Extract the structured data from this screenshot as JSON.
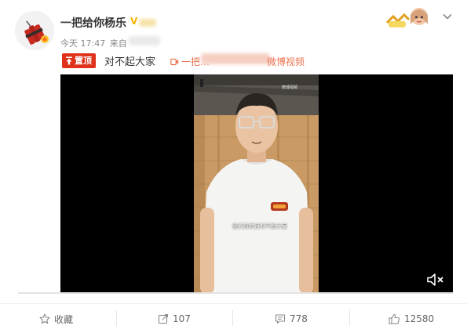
{
  "post": {
    "author": "一把给你杨乐",
    "verified_mark": "V",
    "time": "今天 17:47",
    "source_label": "来自",
    "pinned_label": "置顶",
    "headline": "对不起大家",
    "video_link_label": "一把…",
    "video_link_tail": "微博视频",
    "brand_color": "#e0321b",
    "link_color": "#eb7350"
  },
  "video": {
    "subtitle": "我们真的很对不起大家",
    "watermark": "微博视频",
    "mute_icon": "volume-muted-icon"
  },
  "actions": {
    "favorite_label": "收藏",
    "repost_count": "107",
    "comment_count": "778",
    "like_count": "12580"
  },
  "icons": [
    "star-icon",
    "repost-icon",
    "comment-icon",
    "thumbs-up-icon",
    "chevron-down-icon"
  ]
}
